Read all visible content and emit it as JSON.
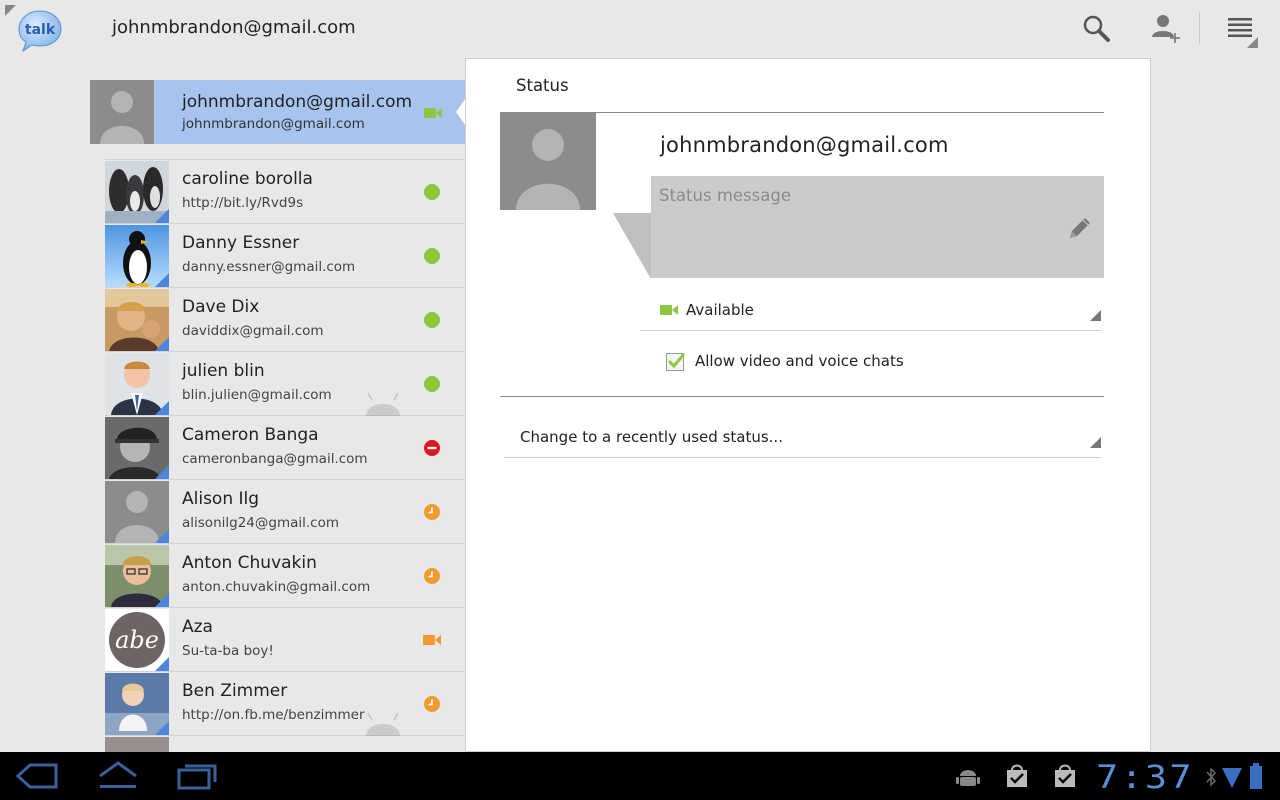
{
  "actionbar": {
    "logo_text": "talk",
    "account": "johnmbrandon@gmail.com",
    "buttons": [
      {
        "name": "search",
        "icon": "search-icon"
      },
      {
        "name": "add-contact",
        "icon": "add-person-icon"
      },
      {
        "name": "menu",
        "icon": "menu-icon"
      }
    ]
  },
  "self": {
    "name": "johnmbrandon@gmail.com",
    "sub": "johnmbrandon@gmail.com",
    "presence": "video"
  },
  "contacts": [
    {
      "name": "caroline borolla",
      "sub": "http://bit.ly/Rvd9s",
      "presence": "available",
      "avatar": "penguins"
    },
    {
      "name": "Danny Essner",
      "sub": "danny.essner@gmail.com",
      "presence": "available",
      "avatar": "penguin"
    },
    {
      "name": "Dave Dix",
      "sub": "daviddix@gmail.com",
      "presence": "available",
      "avatar": "photo-warm"
    },
    {
      "name": "julien blin",
      "sub": "blin.julien@gmail.com",
      "presence": "available",
      "avatar": "photo-suit",
      "android": true
    },
    {
      "name": "Cameron Banga",
      "sub": "cameronbanga@gmail.com",
      "presence": "busy",
      "avatar": "photo-bw"
    },
    {
      "name": "Alison Ilg",
      "sub": "alisonilg24@gmail.com",
      "presence": "idle",
      "avatar": "default"
    },
    {
      "name": "Anton Chuvakin",
      "sub": "anton.chuvakin@gmail.com",
      "presence": "idle",
      "avatar": "photo-glasses"
    },
    {
      "name": "Aza",
      "sub": "Su-ta-ba boy!",
      "presence": "video-idle",
      "avatar": "aza-logo"
    },
    {
      "name": "Ben Zimmer",
      "sub": "http://on.fb.me/benzimmer",
      "presence": "idle",
      "avatar": "photo-baby",
      "android": true
    }
  ],
  "colors": {
    "available": "#8dc63f",
    "busy": "#e0161b",
    "idle": "#f29a2e",
    "selected_row": "#a7c4ee",
    "clock": "#5b8fd8"
  },
  "panel": {
    "title": "Status",
    "account": "johnmbrandon@gmail.com",
    "status_placeholder": "Status message",
    "presence_label": "Available",
    "video_chat_label": "Allow video and voice chats",
    "video_chat_checked": true,
    "recent_label": "Change to a recently used status..."
  },
  "sysbar": {
    "time": "7:37",
    "buttons": [
      "back-icon",
      "home-icon",
      "recent-apps-icon"
    ],
    "notifications": [
      "android-debug-icon",
      "market-update-icon",
      "market-update-icon",
      "bluetooth-icon",
      "wifi-icon",
      "battery-icon"
    ]
  }
}
